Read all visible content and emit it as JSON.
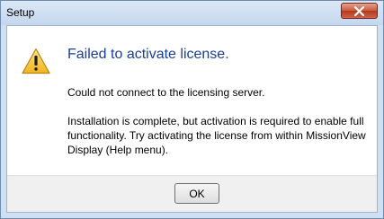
{
  "window": {
    "title": "Setup",
    "close_icon": "close-icon"
  },
  "dialog": {
    "icon": "warning-icon",
    "heading": "Failed to activate license.",
    "message_line": "Could not connect to the licensing server.",
    "message_body": "Installation is complete, but activation is required to enable full functionality. Try activating the license from within MissionView Display (Help menu).",
    "ok_label": "OK"
  },
  "colors": {
    "heading": "#1a3e99",
    "close_button": "#c95a3c",
    "frame": "#cfe0f3",
    "footer": "#f0f0f0"
  }
}
